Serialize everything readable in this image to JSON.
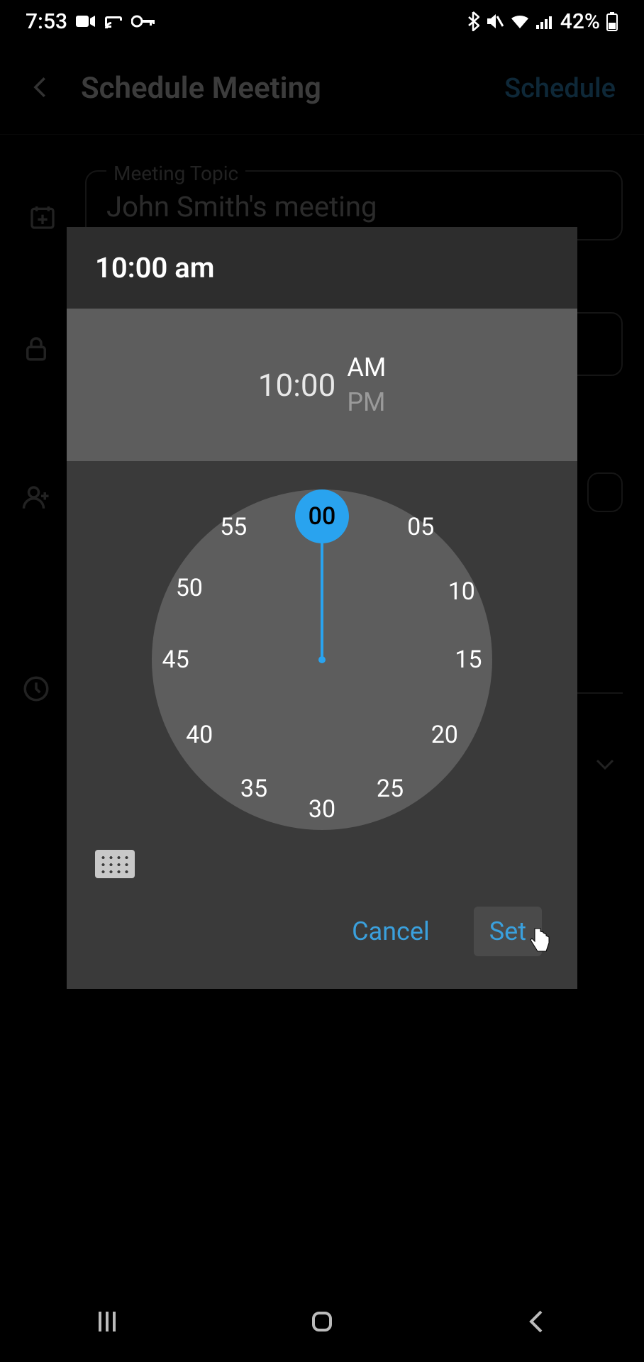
{
  "status": {
    "time": "7:53",
    "battery_text": "42%"
  },
  "header": {
    "title": "Schedule Meeting",
    "action": "Schedule"
  },
  "form": {
    "topic_label": "Meeting Topic",
    "topic_value": "John Smith's meeting"
  },
  "time_picker": {
    "title": "10:00 am",
    "digital_hour": "10",
    "digital_minute": "00",
    "am_label": "AM",
    "pm_label": "PM",
    "selected_period": "AM",
    "selected_minute": "00",
    "clock_values": [
      "00",
      "05",
      "10",
      "15",
      "20",
      "25",
      "30",
      "35",
      "40",
      "45",
      "50",
      "55"
    ],
    "cancel_label": "Cancel",
    "set_label": "Set"
  },
  "colors": {
    "accent": "#29a3ef",
    "link": "#3aa0dd"
  }
}
